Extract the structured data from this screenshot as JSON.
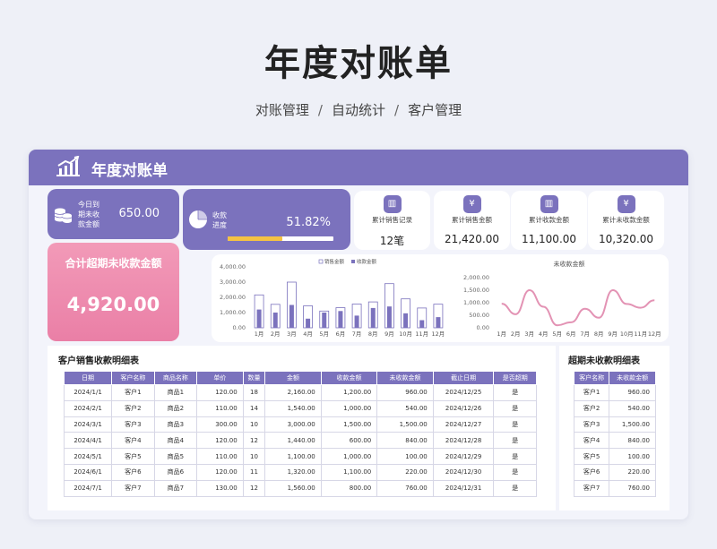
{
  "header": {
    "title": "年度对账单",
    "subtitle_parts": [
      "对账管理",
      "自动统计",
      "客户管理"
    ],
    "separator": "/"
  },
  "panel": {
    "title": "年度对账单",
    "today": {
      "label": "今日到期未收款金额",
      "value": "650.00"
    },
    "rate": {
      "label": "收款进度",
      "value": "51.82%",
      "progress": 0.5182
    },
    "overdue": {
      "label": "合计超期未收款金额",
      "value": "4,920.00"
    },
    "stats": [
      {
        "label": "累计销售记录",
        "value": "12笔",
        "icon": "bar-chart-icon"
      },
      {
        "label": "累计销售金额",
        "value": "21,420.00",
        "icon": "yen-icon"
      },
      {
        "label": "累计收款金额",
        "value": "11,100.00",
        "icon": "bar-chart-icon"
      },
      {
        "label": "累计未收款金额",
        "value": "10,320.00",
        "icon": "yen-icon"
      }
    ],
    "colors": {
      "accent": "#7b72bd",
      "pink": "#ea7fa6",
      "progress": "#f5c242",
      "line": "#e393b4"
    }
  },
  "chart_data": [
    {
      "type": "bar",
      "categories": [
        "1月",
        "2月",
        "3月",
        "4月",
        "5月",
        "6月",
        "7月",
        "8月",
        "9月",
        "10月",
        "11月",
        "12月"
      ],
      "series": [
        {
          "name": "销售金额",
          "values": [
            2160,
            1540,
            3000,
            1440,
            1100,
            1320,
            1560,
            1700,
            2900,
            1900,
            1300,
            1550
          ]
        },
        {
          "name": "收款金额",
          "values": [
            1200,
            1000,
            1500,
            600,
            1000,
            1100,
            800,
            1300,
            1400,
            950,
            500,
            700
          ]
        }
      ],
      "ylim": [
        0,
        4000
      ],
      "yticks": [
        "4,000.00",
        "3,000.00",
        "2,000.00",
        "1,000.00",
        "0.00"
      ],
      "legend": "top-center"
    },
    {
      "type": "line",
      "title": "未收款金额",
      "categories": [
        "1月",
        "2月",
        "3月",
        "4月",
        "5月",
        "6月",
        "7月",
        "8月",
        "9月",
        "10月",
        "11月",
        "12月"
      ],
      "series": [
        {
          "name": "未收款金额",
          "values": [
            960,
            540,
            1500,
            840,
            100,
            220,
            760,
            400,
            1500,
            950,
            800,
            1100
          ]
        }
      ],
      "ylim": [
        0,
        2000
      ],
      "yticks": [
        "2,000.00",
        "1,500.00",
        "1,000.00",
        "500.00",
        "0.00"
      ]
    }
  ],
  "sales_table": {
    "title": "客户销售收款明细表",
    "columns": [
      "日期",
      "客户名称",
      "商品名称",
      "单价",
      "数量",
      "金额",
      "收款金额",
      "未收款金额",
      "截止日期",
      "是否超期"
    ],
    "rows": [
      [
        "2024/1/1",
        "客户1",
        "商品1",
        "120.00",
        "18",
        "2,160.00",
        "1,200.00",
        "960.00",
        "2024/12/25",
        "是"
      ],
      [
        "2024/2/1",
        "客户2",
        "商品2",
        "110.00",
        "14",
        "1,540.00",
        "1,000.00",
        "540.00",
        "2024/12/26",
        "是"
      ],
      [
        "2024/3/1",
        "客户3",
        "商品3",
        "300.00",
        "10",
        "3,000.00",
        "1,500.00",
        "1,500.00",
        "2024/12/27",
        "是"
      ],
      [
        "2024/4/1",
        "客户4",
        "商品4",
        "120.00",
        "12",
        "1,440.00",
        "600.00",
        "840.00",
        "2024/12/28",
        "是"
      ],
      [
        "2024/5/1",
        "客户5",
        "商品5",
        "110.00",
        "10",
        "1,100.00",
        "1,000.00",
        "100.00",
        "2024/12/29",
        "是"
      ],
      [
        "2024/6/1",
        "客户6",
        "商品6",
        "120.00",
        "11",
        "1,320.00",
        "1,100.00",
        "220.00",
        "2024/12/30",
        "是"
      ],
      [
        "2024/7/1",
        "客户7",
        "商品7",
        "130.00",
        "12",
        "1,560.00",
        "800.00",
        "760.00",
        "2024/12/31",
        "是"
      ]
    ]
  },
  "overdue_table": {
    "title": "超期未收款明细表",
    "columns": [
      "客户名称",
      "未收款金额"
    ],
    "rows": [
      [
        "客户1",
        "960.00"
      ],
      [
        "客户2",
        "540.00"
      ],
      [
        "客户3",
        "1,500.00"
      ],
      [
        "客户4",
        "840.00"
      ],
      [
        "客户5",
        "100.00"
      ],
      [
        "客户6",
        "220.00"
      ],
      [
        "客户7",
        "760.00"
      ]
    ]
  }
}
